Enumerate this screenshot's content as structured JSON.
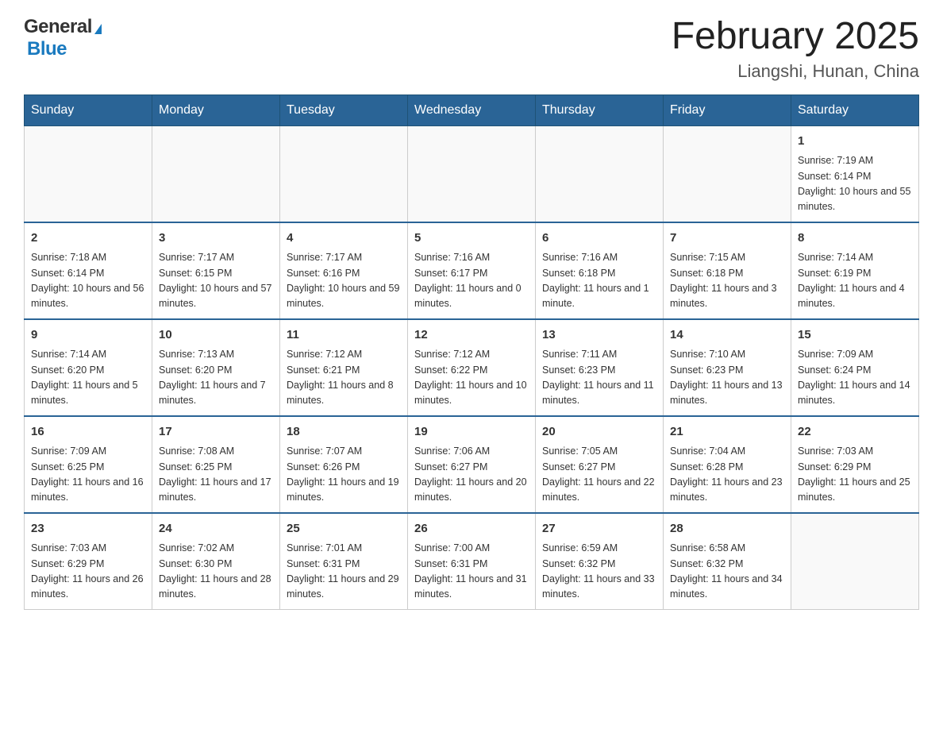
{
  "header": {
    "logo_general": "General",
    "logo_arrow": "▶",
    "logo_blue": "Blue",
    "title": "February 2025",
    "subtitle": "Liangshi, Hunan, China"
  },
  "weekdays": [
    "Sunday",
    "Monday",
    "Tuesday",
    "Wednesday",
    "Thursday",
    "Friday",
    "Saturday"
  ],
  "weeks": [
    [
      {
        "day": "",
        "info": ""
      },
      {
        "day": "",
        "info": ""
      },
      {
        "day": "",
        "info": ""
      },
      {
        "day": "",
        "info": ""
      },
      {
        "day": "",
        "info": ""
      },
      {
        "day": "",
        "info": ""
      },
      {
        "day": "1",
        "info": "Sunrise: 7:19 AM\nSunset: 6:14 PM\nDaylight: 10 hours and 55 minutes."
      }
    ],
    [
      {
        "day": "2",
        "info": "Sunrise: 7:18 AM\nSunset: 6:14 PM\nDaylight: 10 hours and 56 minutes."
      },
      {
        "day": "3",
        "info": "Sunrise: 7:17 AM\nSunset: 6:15 PM\nDaylight: 10 hours and 57 minutes."
      },
      {
        "day": "4",
        "info": "Sunrise: 7:17 AM\nSunset: 6:16 PM\nDaylight: 10 hours and 59 minutes."
      },
      {
        "day": "5",
        "info": "Sunrise: 7:16 AM\nSunset: 6:17 PM\nDaylight: 11 hours and 0 minutes."
      },
      {
        "day": "6",
        "info": "Sunrise: 7:16 AM\nSunset: 6:18 PM\nDaylight: 11 hours and 1 minute."
      },
      {
        "day": "7",
        "info": "Sunrise: 7:15 AM\nSunset: 6:18 PM\nDaylight: 11 hours and 3 minutes."
      },
      {
        "day": "8",
        "info": "Sunrise: 7:14 AM\nSunset: 6:19 PM\nDaylight: 11 hours and 4 minutes."
      }
    ],
    [
      {
        "day": "9",
        "info": "Sunrise: 7:14 AM\nSunset: 6:20 PM\nDaylight: 11 hours and 5 minutes."
      },
      {
        "day": "10",
        "info": "Sunrise: 7:13 AM\nSunset: 6:20 PM\nDaylight: 11 hours and 7 minutes."
      },
      {
        "day": "11",
        "info": "Sunrise: 7:12 AM\nSunset: 6:21 PM\nDaylight: 11 hours and 8 minutes."
      },
      {
        "day": "12",
        "info": "Sunrise: 7:12 AM\nSunset: 6:22 PM\nDaylight: 11 hours and 10 minutes."
      },
      {
        "day": "13",
        "info": "Sunrise: 7:11 AM\nSunset: 6:23 PM\nDaylight: 11 hours and 11 minutes."
      },
      {
        "day": "14",
        "info": "Sunrise: 7:10 AM\nSunset: 6:23 PM\nDaylight: 11 hours and 13 minutes."
      },
      {
        "day": "15",
        "info": "Sunrise: 7:09 AM\nSunset: 6:24 PM\nDaylight: 11 hours and 14 minutes."
      }
    ],
    [
      {
        "day": "16",
        "info": "Sunrise: 7:09 AM\nSunset: 6:25 PM\nDaylight: 11 hours and 16 minutes."
      },
      {
        "day": "17",
        "info": "Sunrise: 7:08 AM\nSunset: 6:25 PM\nDaylight: 11 hours and 17 minutes."
      },
      {
        "day": "18",
        "info": "Sunrise: 7:07 AM\nSunset: 6:26 PM\nDaylight: 11 hours and 19 minutes."
      },
      {
        "day": "19",
        "info": "Sunrise: 7:06 AM\nSunset: 6:27 PM\nDaylight: 11 hours and 20 minutes."
      },
      {
        "day": "20",
        "info": "Sunrise: 7:05 AM\nSunset: 6:27 PM\nDaylight: 11 hours and 22 minutes."
      },
      {
        "day": "21",
        "info": "Sunrise: 7:04 AM\nSunset: 6:28 PM\nDaylight: 11 hours and 23 minutes."
      },
      {
        "day": "22",
        "info": "Sunrise: 7:03 AM\nSunset: 6:29 PM\nDaylight: 11 hours and 25 minutes."
      }
    ],
    [
      {
        "day": "23",
        "info": "Sunrise: 7:03 AM\nSunset: 6:29 PM\nDaylight: 11 hours and 26 minutes."
      },
      {
        "day": "24",
        "info": "Sunrise: 7:02 AM\nSunset: 6:30 PM\nDaylight: 11 hours and 28 minutes."
      },
      {
        "day": "25",
        "info": "Sunrise: 7:01 AM\nSunset: 6:31 PM\nDaylight: 11 hours and 29 minutes."
      },
      {
        "day": "26",
        "info": "Sunrise: 7:00 AM\nSunset: 6:31 PM\nDaylight: 11 hours and 31 minutes."
      },
      {
        "day": "27",
        "info": "Sunrise: 6:59 AM\nSunset: 6:32 PM\nDaylight: 11 hours and 33 minutes."
      },
      {
        "day": "28",
        "info": "Sunrise: 6:58 AM\nSunset: 6:32 PM\nDaylight: 11 hours and 34 minutes."
      },
      {
        "day": "",
        "info": ""
      }
    ]
  ]
}
